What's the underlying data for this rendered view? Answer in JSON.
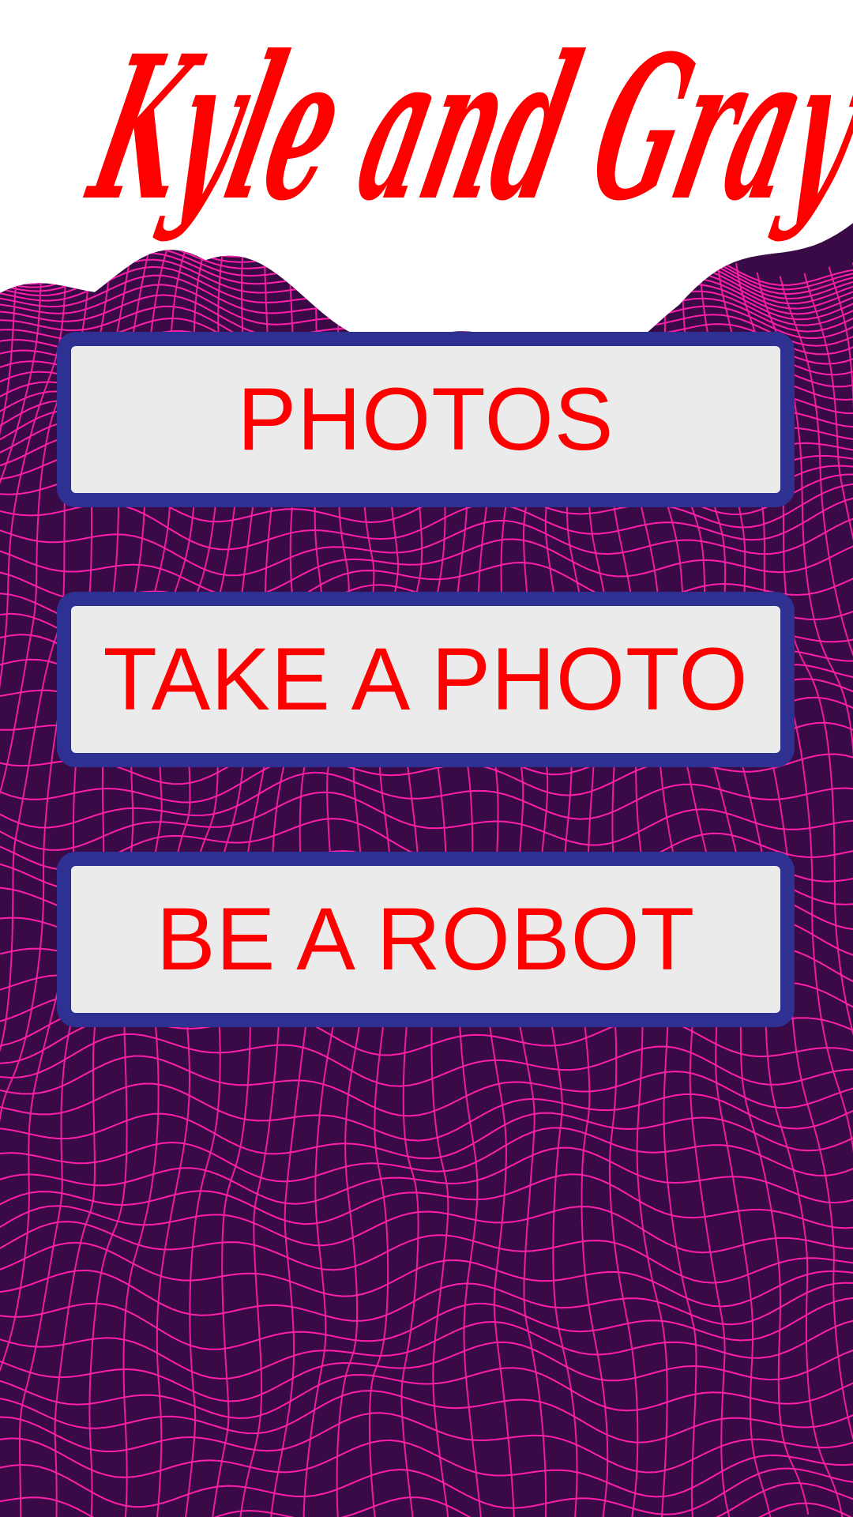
{
  "app": {
    "title": "Kyle and Gray"
  },
  "menu": {
    "items": [
      {
        "label": "PHOTOS"
      },
      {
        "label": "TAKE A PHOTO"
      },
      {
        "label": "BE A ROBOT"
      }
    ]
  },
  "colors": {
    "title": "#ff0000",
    "button_text": "#ff0000",
    "button_border": "#2e3192",
    "button_fill": "#ebebeb",
    "background_base": "#3a0a47",
    "grid_lines": "#ff1fa8"
  },
  "background": {
    "style": "wireframe-terrain",
    "icon": "wireframe-landscape"
  }
}
